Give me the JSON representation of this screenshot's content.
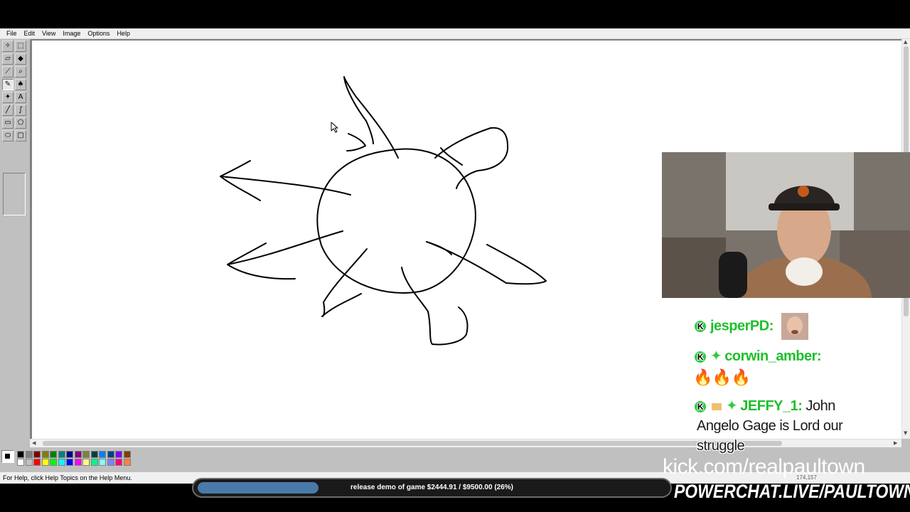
{
  "menu": {
    "items": [
      "File",
      "Edit",
      "View",
      "Image",
      "Options",
      "Help"
    ]
  },
  "status": {
    "help_text": "For Help, click Help Topics on the Help Menu.",
    "coords": "174,157"
  },
  "chat": {
    "messages": [
      {
        "username": "jesperPD:",
        "text": ""
      },
      {
        "username": "corwin_amber:",
        "text": "🔥🔥🔥"
      },
      {
        "username": "JEFFY_1:",
        "text": "John"
      },
      {
        "username": "",
        "text": "Angelo Gage is Lord our"
      },
      {
        "username": "",
        "text": "struggle"
      }
    ]
  },
  "stream": {
    "kick_url": "kick.com/realpaultown",
    "powerchat": "POWERCHAT.LIVE/PAULTOWN"
  },
  "goal": {
    "label": "release demo of game $2444.91 / $9500.00 (26%)",
    "raised": 2444.91,
    "target": 9500.0,
    "percent": 26
  },
  "colors": {
    "chat_username": "#1fbf2b",
    "goal_fill": "#4a7aa8",
    "palette": [
      "#000000",
      "#808080",
      "#800000",
      "#808000",
      "#008000",
      "#008080",
      "#000080",
      "#800080",
      "#808040",
      "#004040",
      "#0080ff",
      "#004080",
      "#8000ff",
      "#804000",
      "#ffffff",
      "#c0c0c0",
      "#ff0000",
      "#ffff00",
      "#00ff00",
      "#00ffff",
      "#0000ff",
      "#ff00ff",
      "#ffff80",
      "#00ff80",
      "#80ffff",
      "#8080ff",
      "#ff0080",
      "#ff8040"
    ]
  }
}
